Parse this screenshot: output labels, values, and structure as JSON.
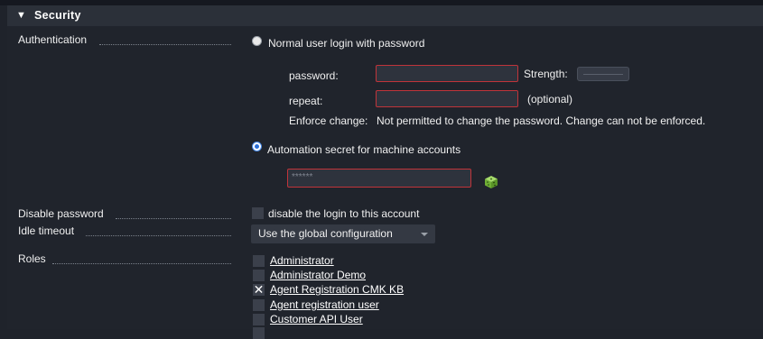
{
  "section": {
    "title": "Security",
    "toggle_icon": "triangle-down-icon"
  },
  "authentication": {
    "label": "Authentication",
    "option_password": "Normal user login with password",
    "password_label": "password:",
    "strength_label": "Strength:",
    "repeat_label": "repeat:",
    "optional_text": "(optional)",
    "enforce_label": "Enforce change:",
    "enforce_text": "Not permitted to change the password. Change can not be enforced.",
    "option_automation": "Automation secret for machine accounts",
    "secret_value": "******",
    "selected_option": "automation",
    "dice_icon": "dice-icon",
    "colors": {
      "error_border": "#c0343a",
      "dice_green": "#7bc043"
    }
  },
  "disable_password": {
    "label": "Disable password",
    "checkbox_label": "disable the login to this account",
    "checked": false
  },
  "idle_timeout": {
    "label": "Idle timeout",
    "selected": "Use the global configuration"
  },
  "roles": {
    "label": "Roles",
    "items": [
      {
        "name": "Administrator",
        "checked": false
      },
      {
        "name": "Administrator Demo",
        "checked": false
      },
      {
        "name": "Agent Registration CMK KB",
        "checked": true
      },
      {
        "name": "Agent registration user",
        "checked": false
      },
      {
        "name": "Customer API User",
        "checked": false
      }
    ]
  }
}
